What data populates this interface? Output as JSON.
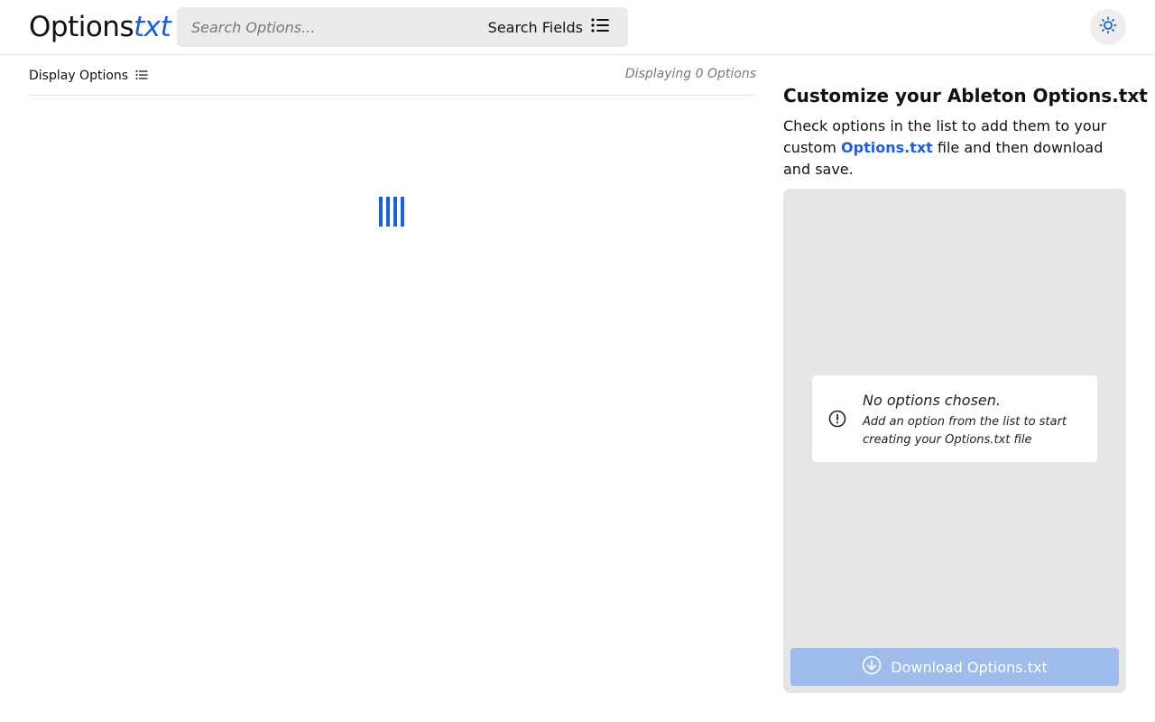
{
  "brand": {
    "name_main": "Options",
    "name_ext": "txt"
  },
  "search": {
    "placeholder": "Search Options...",
    "value": "",
    "fields_label": "Search Fields"
  },
  "icons": {
    "list": "list-icon",
    "theme": "sun-icon",
    "alert": "alert-circle-icon",
    "download": "download-circle-icon"
  },
  "list": {
    "display_label": "Display Options",
    "count_label": "Displaying 0 Options"
  },
  "sidebar": {
    "title": "Customize your Ableton Options.txt",
    "desc_before": "Check options in the list to add them to your custom",
    "desc_link": "Options.txt",
    "desc_after": " file and then download and save."
  },
  "empty_state": {
    "title": "No options chosen.",
    "body": "Add an option from the list to start creating your Options.txt file"
  },
  "download": {
    "label": "Download Options.txt",
    "disabled": true
  },
  "colors": {
    "accent": "#1a5fe0",
    "panel": "#e5e5e5",
    "button_disabled": "#9dbcec"
  }
}
